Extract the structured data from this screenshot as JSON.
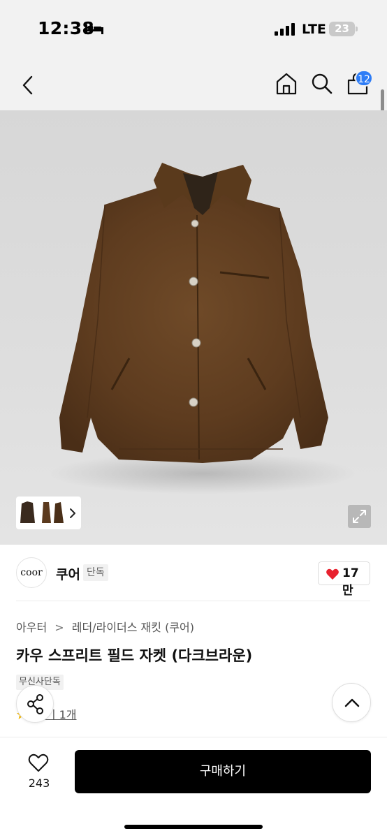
{
  "status_bar": {
    "time": "12:38",
    "network": "LTE",
    "battery": "23",
    "icons": [
      "bed-icon",
      "signal-icon",
      "battery-icon"
    ]
  },
  "nav": {
    "icons": [
      "back-chevron-icon",
      "home-icon",
      "search-icon",
      "cart-icon"
    ],
    "cart_count": "12"
  },
  "gallery": {
    "icons": [
      "expand-icon",
      "chevron-right-icon"
    ]
  },
  "brand": {
    "logo_text": "coor",
    "name": "쿠어",
    "tag": "단독",
    "likes": "17만",
    "like_icon": "heart-icon",
    "like_color": "#e8212e"
  },
  "breadcrumb": {
    "items": [
      "아우터",
      "레더/라이더스 재킷 (쿠어)"
    ],
    "separator": ">"
  },
  "product": {
    "title": "카우 스프리트 필드 자켓 (다크브라운)",
    "exclusive_tag": "무신사단독",
    "review_label": "후기 1개",
    "review_icon": "star-icon",
    "review_star_color": "#f5b800"
  },
  "floating": {
    "icons": [
      "share-icon",
      "arrow-up-icon"
    ]
  },
  "bottom_bar": {
    "wish_count": "243",
    "buy_label": "구매하기",
    "buy_color": "#000000"
  }
}
